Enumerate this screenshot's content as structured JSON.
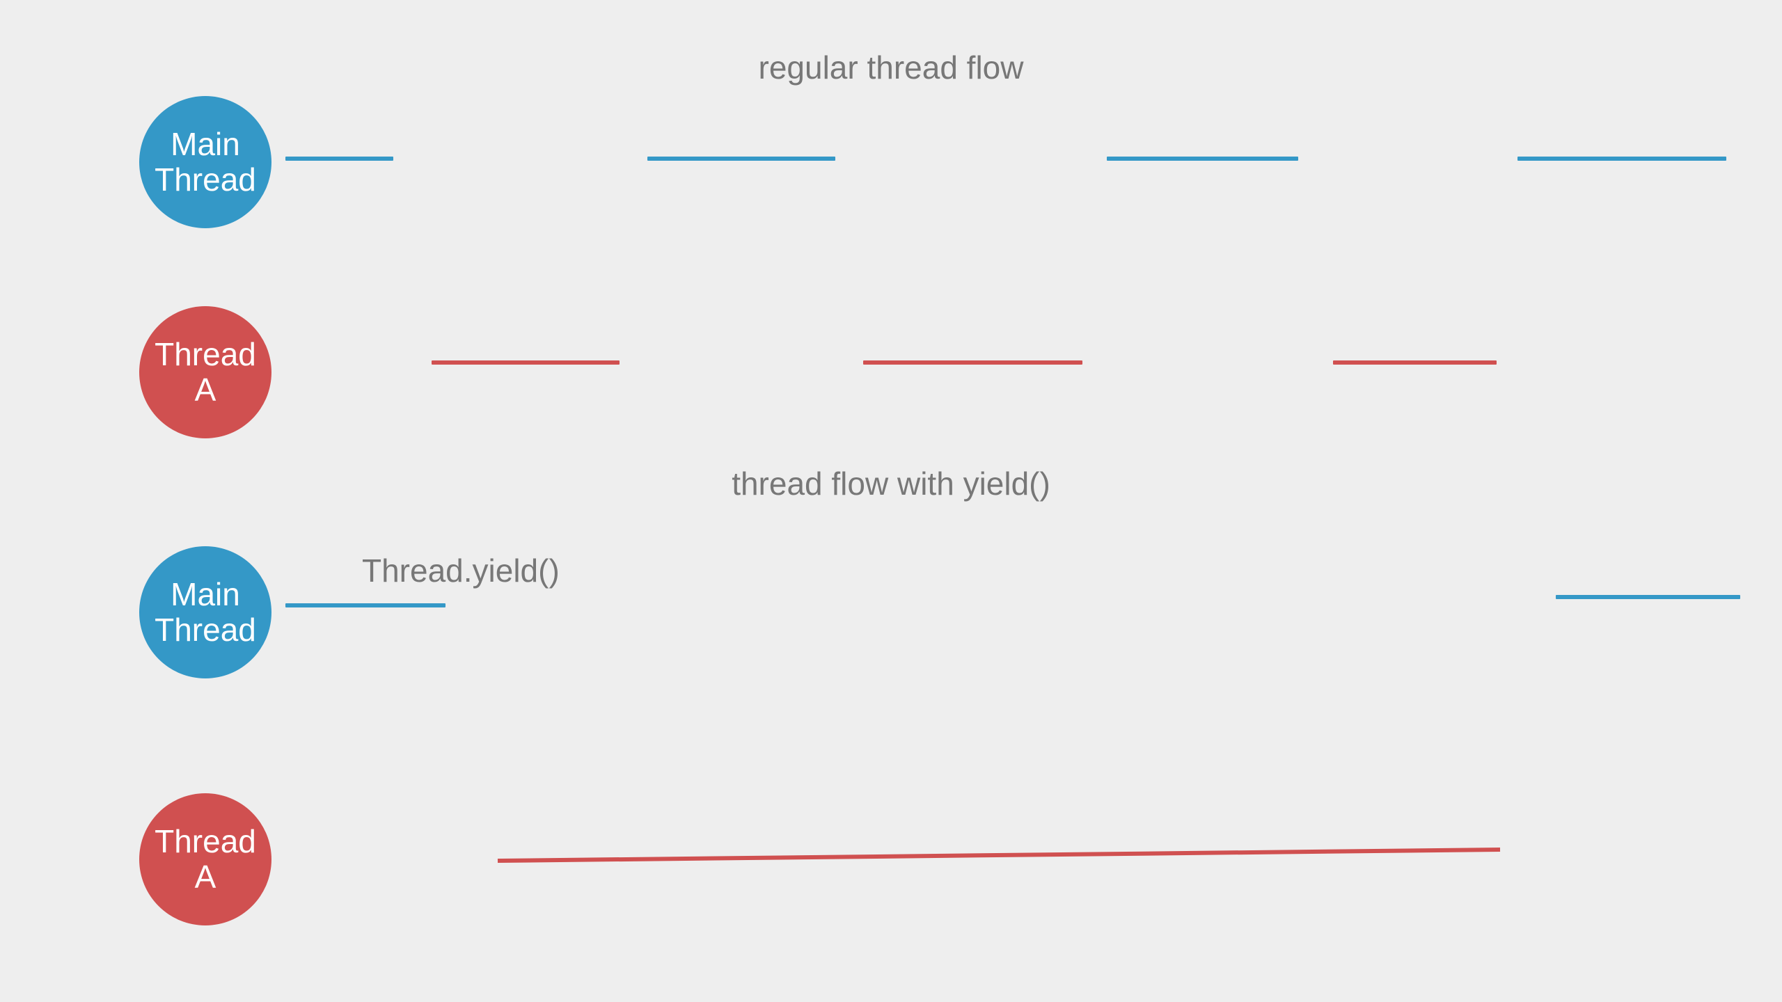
{
  "titles": {
    "regular": "regular thread flow",
    "yield": "thread flow with yield()"
  },
  "annotation": {
    "yield_call": "Thread.yield()"
  },
  "nodes": {
    "main1": {
      "line1": "Main",
      "line2": "Thread"
    },
    "threadA1": {
      "line1": "Thread",
      "line2": "A"
    },
    "main2": {
      "line1": "Main",
      "line2": "Thread"
    },
    "threadA2": {
      "line1": "Thread",
      "line2": "A"
    }
  },
  "colors": {
    "blue": "#3498c7",
    "red": "#d05050",
    "bg": "#eeeeee",
    "text_gray": "#777777"
  },
  "chart_data": {
    "type": "timeline",
    "description": "Two timeline diagrams comparing CPU scheduling between Main Thread (blue) and Thread A (red).",
    "panels": [
      {
        "title": "regular thread flow",
        "threads": [
          {
            "name": "Main Thread",
            "color": "blue",
            "segments": [
              {
                "start": 0.0,
                "end": 0.09
              },
              {
                "start": 0.3,
                "end": 0.46
              },
              {
                "start": 0.69,
                "end": 0.85
              },
              {
                "start": 1.03,
                "end": 1.2
              }
            ]
          },
          {
            "name": "Thread A",
            "color": "red",
            "segments": [
              {
                "start": 0.12,
                "end": 0.28
              },
              {
                "start": 0.49,
                "end": 0.67
              },
              {
                "start": 0.88,
                "end": 1.01
              }
            ]
          }
        ]
      },
      {
        "title": "thread flow with yield()",
        "annotation": "Thread.yield()",
        "threads": [
          {
            "name": "Main Thread",
            "color": "blue",
            "segments": [
              {
                "start": 0.0,
                "end": 0.13
              },
              {
                "start": 1.07,
                "end": 1.2
              }
            ]
          },
          {
            "name": "Thread A",
            "color": "red",
            "segments": [
              {
                "start": 0.18,
                "end": 1.01
              }
            ]
          }
        ]
      }
    ],
    "x_range": [
      0,
      1.2
    ]
  }
}
